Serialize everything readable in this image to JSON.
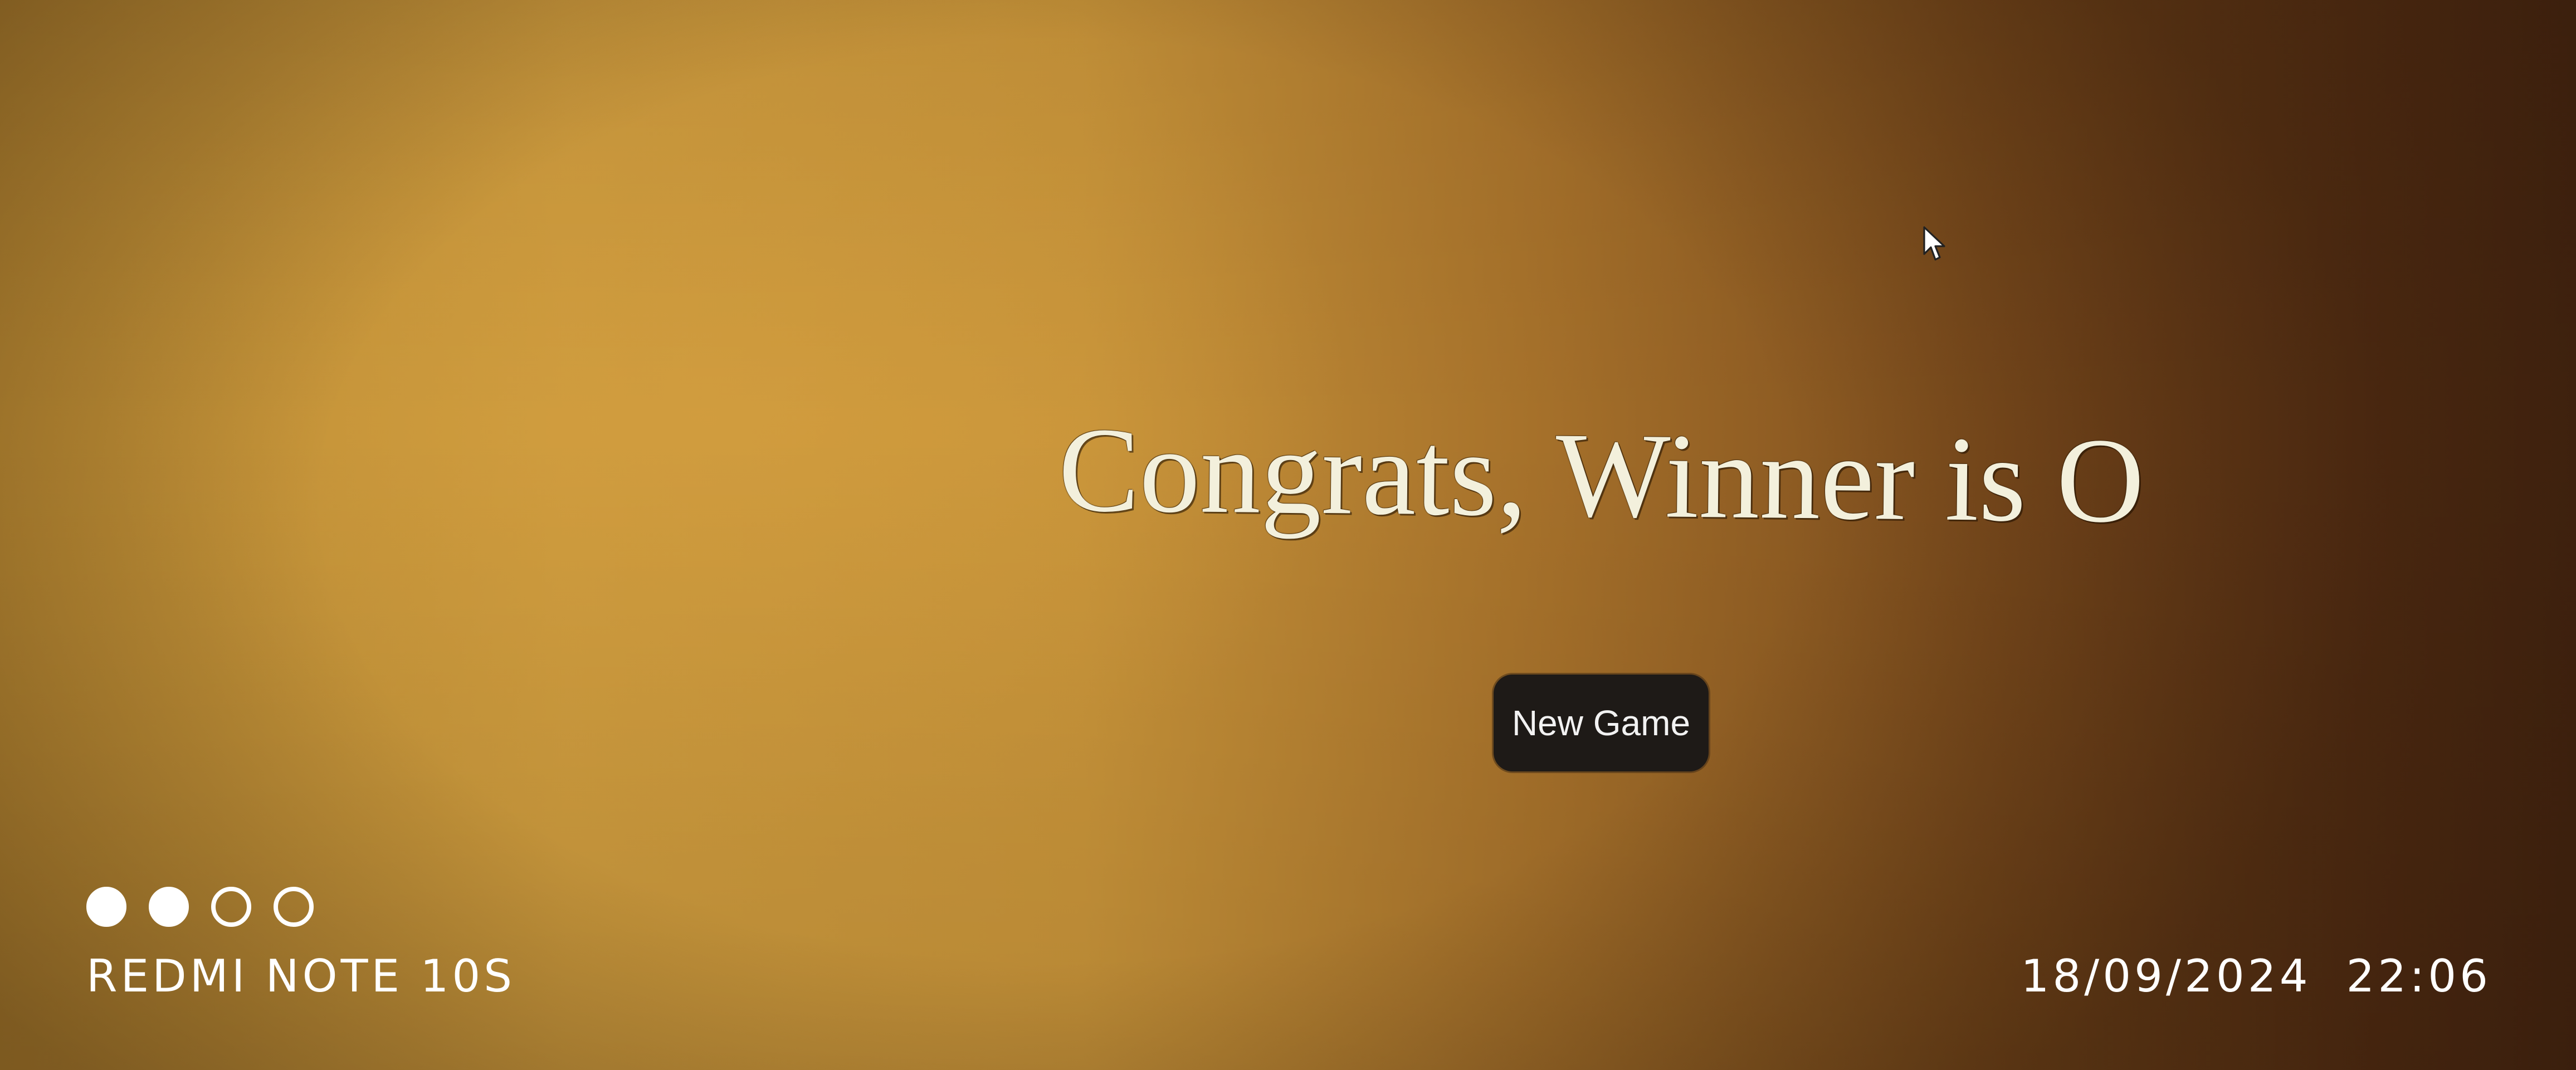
{
  "game": {
    "result_message": "Congrats, Winner is O",
    "new_game_label": "New Game"
  },
  "watermark": {
    "device_model": "REDMI NOTE 10S",
    "datetime": "18/09/2024  22:06",
    "dots": [
      "filled",
      "filled",
      "empty",
      "empty"
    ]
  },
  "icons": {
    "cursor": "mouse-pointer-icon"
  },
  "colors": {
    "title_text": "#f3f0dc",
    "button_background": "#1e1a17",
    "button_text": "#f2f2f2",
    "watermark_text": "#ffffff"
  }
}
